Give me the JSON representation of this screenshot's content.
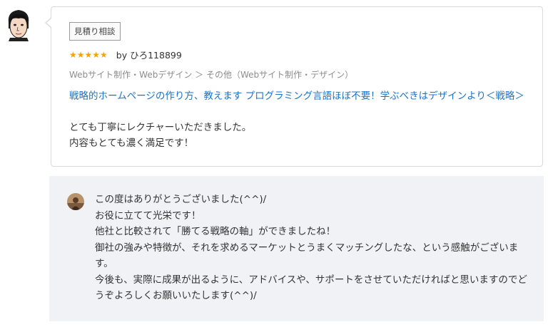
{
  "review": {
    "badge": "見積り相談",
    "stars": "★★★★★",
    "reviewer": "by ひろ118899",
    "category": "Webサイト制作・Webデザイン ＞ その他（Webサイト制作・デザイン）",
    "service_title": "戦略的ホームページの作り方、教えます プログラミング言語ほぼ不要！学ぶべきはデザインより＜戦略＞",
    "comment_lines": [
      "とても丁寧にレクチャーいただきました。",
      "内容もとても濃く満足です！"
    ]
  },
  "reply": {
    "lines": [
      "この度はありがとうございました(^^)/",
      "お役に立てて光栄です！",
      "他社と比較されて「勝てる戦略の軸」ができましたね！",
      "御社の強みや特徴が、それを求めるマーケットとうまくマッチングしたな、という感触がございます。",
      "今後も、実際に成果が出るように、アドバイスや、サポートをさせていただければと思いますのでどうぞよろしくお願いいたします(^^)/"
    ]
  },
  "colors": {
    "link": "#1b73c9",
    "star": "#f5a300",
    "reply_bg": "#f0f2f5"
  },
  "icons": {
    "reviewer_avatar": "cartoon-face-avatar",
    "seller_avatar": "photo-avatar"
  }
}
